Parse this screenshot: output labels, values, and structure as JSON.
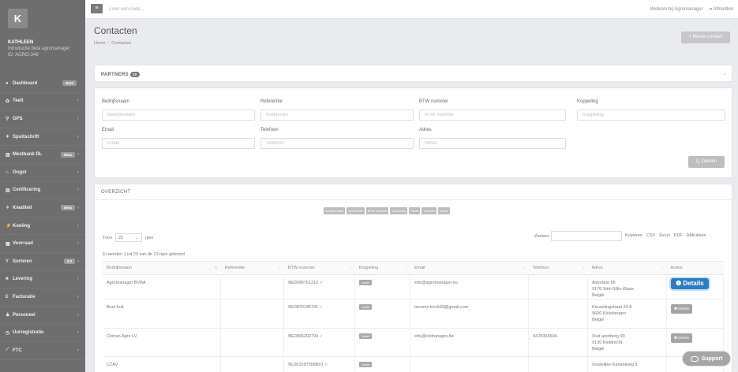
{
  "app": {
    "logo_letter": "K"
  },
  "user": {
    "name": "KATHLEEN",
    "subtitle": "Introductie beta agromanager",
    "id": "ID: AGRO-348"
  },
  "sidebar": {
    "items": [
      {
        "icon": "dashboard-icon",
        "glyph": "●",
        "label": "Dashboard",
        "badge": "Beta",
        "chevron": ""
      },
      {
        "icon": "leaf-icon",
        "glyph": "✿",
        "label": "Teelt",
        "badge": "",
        "chevron": "‹"
      },
      {
        "icon": "location-icon",
        "glyph": "⚲",
        "label": "GPS",
        "badge": "",
        "chevron": "‹"
      },
      {
        "icon": "spray-icon",
        "glyph": "✦",
        "label": "Spuitschrift",
        "badge": "",
        "chevron": "‹"
      },
      {
        "icon": "bank-icon",
        "glyph": "▥",
        "label": "Mestbank DL",
        "badge": "Beta",
        "chevron": "‹"
      },
      {
        "icon": "harvest-icon",
        "glyph": "⌂",
        "label": "Oogst",
        "badge": "",
        "chevron": "‹"
      },
      {
        "icon": "certificate-icon",
        "glyph": "▤",
        "label": "Certificering",
        "badge": "",
        "chevron": "‹"
      },
      {
        "icon": "quality-icon",
        "glyph": "✧",
        "label": "Kwaliteit",
        "badge": "Beta",
        "chevron": "‹"
      },
      {
        "icon": "cooling-icon",
        "glyph": "⚡",
        "label": "Koeling",
        "badge": "",
        "chevron": "‹"
      },
      {
        "icon": "stock-icon",
        "glyph": "▦",
        "label": "Voorraad",
        "badge": "",
        "chevron": "‹"
      },
      {
        "icon": "sort-icon",
        "glyph": "Y",
        "label": "Sorteren",
        "badge": "3.0",
        "chevron": "‹"
      },
      {
        "icon": "delivery-icon",
        "glyph": "■",
        "label": "Levering",
        "badge": "",
        "chevron": "‹"
      },
      {
        "icon": "invoice-icon",
        "glyph": "€",
        "label": "Facturatie",
        "badge": "",
        "chevron": "‹"
      },
      {
        "icon": "staff-icon",
        "glyph": "♟",
        "label": "Personeel",
        "badge": "",
        "chevron": "‹"
      },
      {
        "icon": "clock-icon",
        "glyph": "◷",
        "label": "Uurregistratie",
        "badge": "",
        "chevron": "‹"
      },
      {
        "icon": "chart-icon",
        "glyph": "⟋",
        "label": "FTC",
        "badge": "",
        "chevron": "‹"
      }
    ]
  },
  "topbar": {
    "search_placeholder": "Zoek een code...",
    "welcome": "Welkom bij Agromanager",
    "logout": "Afmelden"
  },
  "header": {
    "title": "Contacten",
    "breadcrumb": [
      "Home",
      "Contacten"
    ],
    "new_contact": "+ Nieuw contact"
  },
  "partners": {
    "title": "PARTNERS",
    "count": "20"
  },
  "filters": {
    "fields": [
      {
        "label": "Bedrijfsnaam",
        "placeholder": "Bedrijfsnaam"
      },
      {
        "label": "Referentie",
        "placeholder": "Referentie"
      },
      {
        "label": "BTW nummer",
        "placeholder": "BTW nummer"
      },
      {
        "label": "Koppeling",
        "placeholder": "Koppeling"
      },
      {
        "label": "Email",
        "placeholder": "Email"
      },
      {
        "label": "Telefoon",
        "placeholder": "Telefoon"
      },
      {
        "label": "Adres",
        "placeholder": "Adres"
      }
    ],
    "search_button": "Q Zoeken"
  },
  "overview": {
    "title": "OVERZICHT",
    "column_toggles": [
      "Bedrijfsnaam",
      "Referentie",
      "BTW nummer",
      "Koppeling",
      "Email",
      "Telefoon",
      "Adres"
    ],
    "show_label": "Toon",
    "page_size": "25",
    "rows_label": "rijen",
    "search_label": "Zoeken",
    "exports": [
      "Kopieren",
      "CSV",
      "Excel",
      "PDF",
      "Afdrukken"
    ],
    "info": "Er worden 1 tot 23 van de 23 rijen getoond",
    "columns": [
      "Bedrijfsnaam",
      "Referentie",
      "BTW nummer",
      "Koppeling",
      "Email",
      "Telefoon",
      "Adres",
      "Acties"
    ],
    "rows": [
      {
        "name": "Agromanager BVBA",
        "ref": "",
        "btw": "BE0696761312",
        "koppeling": "Actief",
        "email": "info@agromanager.eu",
        "tel": "",
        "adres": [
          "Astotraat 66",
          "9170 Sint-Gillis-Waas",
          "België"
        ],
        "action": "Details"
      },
      {
        "name": "Best fruit",
        "ref": "",
        "btw": "BE0879145741",
        "koppeling": "Actief",
        "email": "laurens.torck93@gmail.com",
        "tel": "",
        "adres": [
          "Keuzelingstraat 24 A",
          "9600 Kluisbergen",
          "België"
        ],
        "action": "Details"
      },
      {
        "name": "Clotran Agro LV.",
        "ref": "",
        "btw": "BE0896202794",
        "koppeling": "Actief",
        "email": "info@clotranagro.be",
        "tel": "0478365504",
        "adres": [
          "Oud arenberg 90",
          "9130 Kieldrecht",
          "België"
        ],
        "action": "Details"
      },
      {
        "name": "CZAV",
        "ref": "",
        "btw": "NL001597358B01",
        "koppeling": "Actief",
        "email": "",
        "tel": "",
        "adres": [
          "Oostelijke Kanaalweg 5"
        ],
        "action": ""
      }
    ]
  },
  "support": {
    "label": "Support"
  }
}
